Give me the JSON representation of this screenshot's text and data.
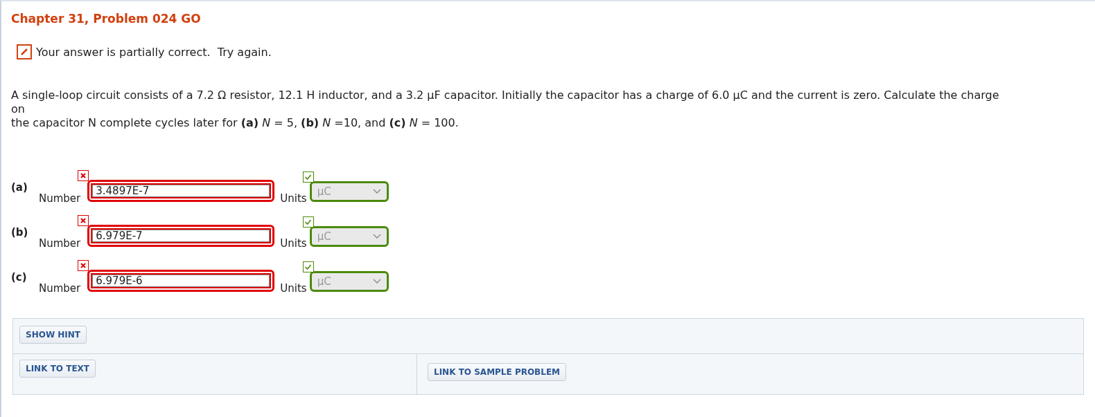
{
  "title": "Chapter 31, Problem 024 GO",
  "status": {
    "correct": false,
    "text": "Your answer is partially correct.  Try again."
  },
  "problem_lines": [
    "A single-loop circuit consists of a 7.2 Ω resistor, 12.1 H inductor, and a 3.2 μF capacitor. Initially the capacitor has a charge of 6.0 μC and the current is zero. Calculate the charge on",
    "the capacitor N complete cycles later for **(a)** *N* = 5, **(b)** *N* =10, and **(c)** *N* = 100."
  ],
  "parts": [
    {
      "label": "(a)",
      "number_label": "Number",
      "value": "3.4897E-7",
      "value_correct": false,
      "units_label": "Units",
      "units": "µC",
      "units_correct": true
    },
    {
      "label": "(b)",
      "number_label": "Number",
      "value": "6.979E-7",
      "value_correct": false,
      "units_label": "Units",
      "units": "µC",
      "units_correct": true
    },
    {
      "label": "(c)",
      "number_label": "Number",
      "value": "6.979E-6",
      "value_correct": false,
      "units_label": "Units",
      "units": "µC",
      "units_correct": true
    }
  ],
  "buttons": {
    "hint": "SHOW HINT",
    "text_link": "LINK TO TEXT",
    "sample_link": "LINK TO SAMPLE PROBLEM"
  }
}
